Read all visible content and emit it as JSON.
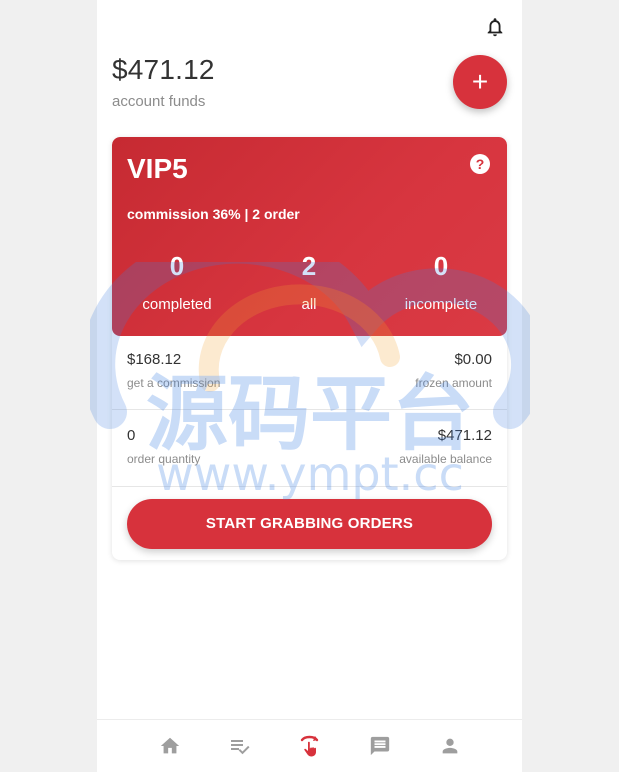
{
  "account": {
    "funds": "$471.12",
    "funds_label": "account funds",
    "add_label": "+"
  },
  "vip": {
    "level": "VIP5",
    "help": "?",
    "commission_text": "commission 36% | 2 order",
    "stats": [
      {
        "value": "0",
        "label": "completed"
      },
      {
        "value": "2",
        "label": "all"
      },
      {
        "value": "0",
        "label": "incomplete"
      }
    ]
  },
  "summary": [
    {
      "left_value": "$168.12",
      "left_label": "get a commission",
      "right_value": "$0.00",
      "right_label": "frozen amount"
    },
    {
      "left_value": "0",
      "left_label": "order quantity",
      "right_value": "$471.12",
      "right_label": "available balance"
    }
  ],
  "grab_button": "START GRABBING ORDERS",
  "watermark": {
    "cn": "源码平台",
    "url": "www.ympt.cc"
  },
  "nav": [
    {
      "icon": "home-icon"
    },
    {
      "icon": "orders-icon"
    },
    {
      "icon": "grab-icon",
      "active": true
    },
    {
      "icon": "message-icon"
    },
    {
      "icon": "profile-icon"
    }
  ],
  "colors": {
    "accent": "#d7323c",
    "nav_inactive": "#9e9e9e"
  }
}
